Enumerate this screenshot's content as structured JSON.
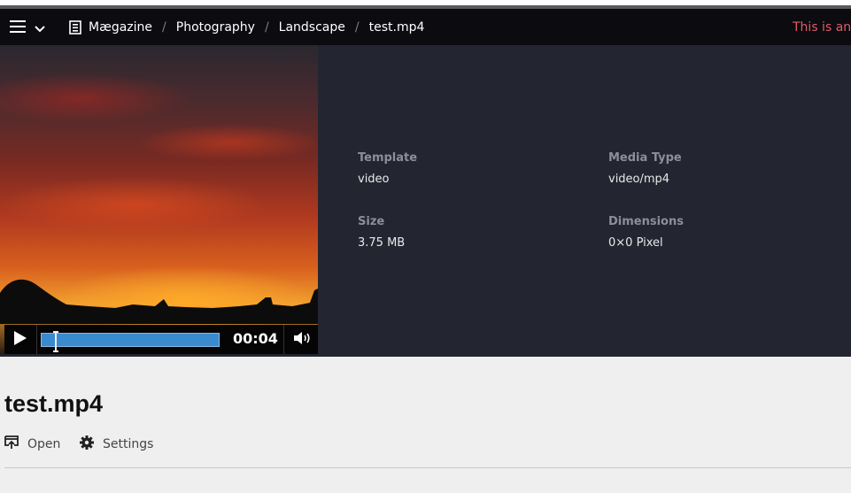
{
  "header": {
    "breadcrumbs": [
      {
        "label": "Mægazine"
      },
      {
        "label": "Photography"
      },
      {
        "label": "Landscape"
      },
      {
        "label": "test.mp4"
      }
    ],
    "warning": "This is an u"
  },
  "video": {
    "timecode": "00:04",
    "progress_percent": 5
  },
  "metadata": {
    "template_label": "Template",
    "template_value": "video",
    "media_type_label": "Media Type",
    "media_type_value": "video/mp4",
    "size_label": "Size",
    "size_value": "3.75 MB",
    "dimensions_label": "Dimensions",
    "dimensions_value": "0×0 Pixel"
  },
  "main": {
    "title": "test.mp4",
    "open_label": "Open",
    "settings_label": "Settings"
  },
  "colors": {
    "header_bg": "#0b0b10",
    "panel_bg": "#232631",
    "warning": "#e05b66",
    "progress": "#3a8ad0"
  },
  "icons": [
    "menu-icon",
    "chevron-down-icon",
    "page-icon",
    "play-icon",
    "volume-icon",
    "open-icon",
    "gear-icon"
  ]
}
